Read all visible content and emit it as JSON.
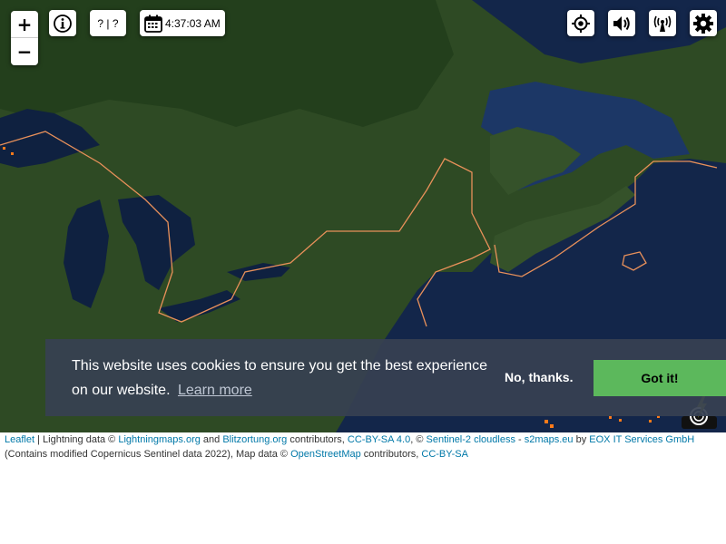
{
  "map": {
    "zoom_in_label": "+",
    "zoom_out_label": "−",
    "info_icon": "info-icon",
    "stats_label": "? | ?",
    "clock_time": "4:37:03 AM",
    "calendar_icon": "calendar-icon",
    "right_controls": [
      "locate-icon",
      "speaker-icon",
      "antenna-icon",
      "gear-icon"
    ],
    "colors": {
      "ocean": "#13264a",
      "land": "#2f4a24",
      "border": "#e8905a",
      "strike": "#ff7a1a"
    }
  },
  "cookie": {
    "message": "This website uses cookies to ensure you get the best experience on our website.",
    "learn_more": "Learn more",
    "decline": "No, thanks.",
    "accept": "Got it!"
  },
  "attribution": {
    "leaflet": "Leaflet",
    "sep": " | ",
    "lightning_prefix": "Lightning data © ",
    "lightningmaps": "Lightningmaps.org",
    "and": " and ",
    "blitzortung": "Blitzortung.org",
    "contributors1": " contributors, ",
    "ccbysa40": "CC-BY-SA 4.0",
    "copy2": ", © ",
    "sentinel": "Sentinel-2 cloudless",
    "dash": " - ",
    "s2maps": "s2maps.eu",
    "by": " by ",
    "eox": "EOX IT Services GmbH",
    "line2_prefix": "(Contains modified Copernicus Sentinel data 2022), Map data © ",
    "osm": "OpenStreetMap",
    "contributors2": " contributors, ",
    "ccbysa": "CC-BY-SA"
  }
}
